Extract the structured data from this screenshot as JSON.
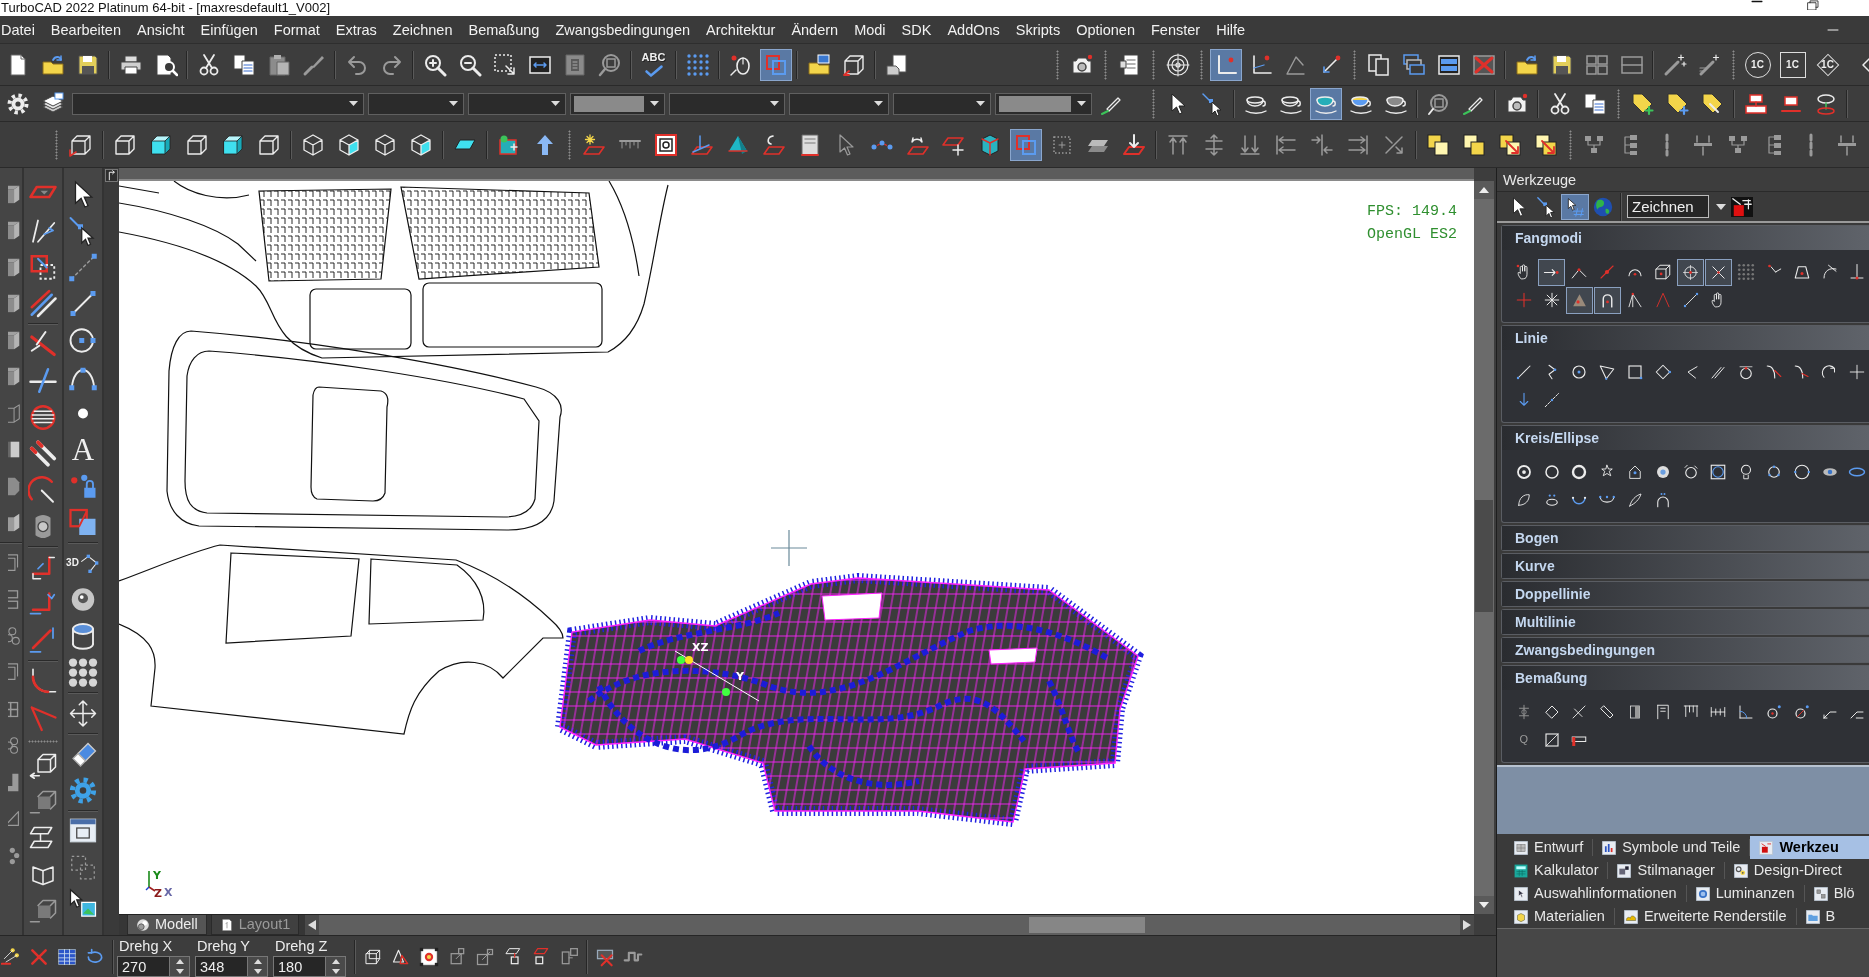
{
  "window": {
    "title": "TurboCAD 2022 Platinum 64-bit - [maxresdefault1_V002]"
  },
  "menu": [
    "Datei",
    "Bearbeiten",
    "Ansicht",
    "Einfügen",
    "Format",
    "Extras",
    "Zeichnen",
    "Bemaßung",
    "Zwangsbedingungen",
    "Architektur",
    "Ändern",
    "Modi",
    "SDK",
    "AddOns",
    "Skripts",
    "Optionen",
    "Fenster",
    "Hilfe"
  ],
  "toolbars": {
    "standard": [
      {
        "selected": false
      },
      {
        "selected": false
      },
      {
        "selected": false
      },
      {
        "selected": false
      },
      {
        "selected": false
      },
      {
        "selected": false
      },
      {
        "selected": false
      },
      {
        "selected": false
      },
      {
        "selected": false
      },
      {
        "selected": false
      },
      {
        "selected": false
      },
      {
        "selected": false
      },
      {
        "selected": false
      },
      {
        "selected": false
      },
      {
        "selected": false
      },
      {
        "selected": false
      },
      {
        "selected": false
      },
      {
        "selected": false,
        "label": "ABC"
      },
      {
        "selected": false
      },
      {
        "selected": false
      },
      {
        "selected": true
      },
      {
        "selected": false
      },
      {
        "selected": false
      },
      {
        "selected": false
      },
      {
        "selected": false
      },
      {
        "selected": false
      },
      {
        "selected": false
      },
      {
        "selected": true
      },
      {
        "selected": false
      },
      {
        "selected": false
      },
      {
        "selected": false
      },
      {
        "selected": false
      },
      {
        "selected": false
      },
      {
        "selected": false
      },
      {
        "selected": false
      },
      {
        "selected": false
      },
      {
        "selected": false
      },
      {
        "selected": false
      },
      {
        "selected": false
      },
      {
        "selected": false
      },
      {
        "selected": false
      },
      {
        "selected": false,
        "label": "1C"
      },
      {
        "selected": false,
        "label": "1C"
      },
      {
        "selected": false,
        "label": "1C"
      },
      {
        "selected": false
      }
    ],
    "properties": [
      {
        "selected": false
      },
      {
        "selected": false
      },
      {
        "selected": false
      },
      {
        "selected": false
      },
      {
        "selected": false
      },
      {
        "selected": false
      },
      {
        "selected": false
      },
      {
        "selected": true
      },
      {
        "selected": false
      },
      {
        "selected": false
      },
      {
        "selected": false
      },
      {
        "selected": false
      },
      {
        "selected": false
      },
      {
        "selected": false
      },
      {
        "selected": false
      },
      {
        "selected": false
      },
      {
        "selected": false
      },
      {
        "selected": false
      },
      {
        "selected": false
      },
      {
        "selected": false
      },
      {
        "selected": false
      }
    ],
    "view": [
      {
        "selected": false
      },
      {
        "selected": false
      },
      {
        "selected": false
      },
      {
        "selected": false
      },
      {
        "selected": false
      },
      {
        "selected": false
      },
      {
        "selected": false
      },
      {
        "selected": false
      },
      {
        "selected": false
      },
      {
        "selected": false
      },
      {
        "selected": false
      },
      {
        "selected": false
      },
      {
        "selected": false
      },
      {
        "selected": false
      },
      {
        "selected": false
      },
      {
        "selected": false
      },
      {
        "selected": false
      },
      {
        "selected": false
      },
      {
        "selected": false
      },
      {
        "selected": false
      },
      {
        "selected": false
      },
      {
        "selected": false
      },
      {
        "selected": false
      },
      {
        "selected": false
      },
      {
        "selected": false
      },
      {
        "selected": true
      },
      {
        "selected": false
      },
      {
        "selected": false
      },
      {
        "selected": false
      },
      {
        "selected": false
      },
      {
        "selected": false
      },
      {
        "selected": false
      },
      {
        "selected": false
      },
      {
        "selected": false
      },
      {
        "selected": false
      },
      {
        "selected": false
      },
      {
        "selected": false
      },
      {
        "selected": false
      },
      {
        "selected": false
      },
      {
        "selected": false
      },
      {
        "selected": false
      },
      {
        "selected": false
      },
      {
        "selected": false
      },
      {
        "selected": false
      },
      {
        "selected": false
      },
      {
        "selected": false
      },
      {
        "selected": false
      },
      {
        "selected": false
      }
    ],
    "left_1": [
      {
        "selected": false
      },
      {
        "selected": false
      },
      {
        "selected": false
      },
      {
        "selected": false
      },
      {
        "selected": false
      },
      {
        "selected": false
      },
      {
        "selected": false
      },
      {
        "selected": false
      },
      {
        "selected": false
      },
      {
        "selected": false
      },
      {
        "selected": false
      },
      {
        "selected": false
      },
      {
        "selected": false
      },
      {
        "selected": false
      },
      {
        "selected": false
      },
      {
        "selected": false
      },
      {
        "selected": false
      },
      {
        "selected": false
      },
      {
        "selected": false
      }
    ],
    "left_2": [
      {
        "selected": false
      },
      {
        "selected": false
      },
      {
        "selected": false
      },
      {
        "selected": false
      },
      {
        "selected": false
      },
      {
        "selected": false
      },
      {
        "selected": false
      },
      {
        "selected": false
      },
      {
        "selected": false
      },
      {
        "selected": false
      },
      {
        "selected": false
      },
      {
        "selected": false
      },
      {
        "selected": false
      },
      {
        "selected": false
      },
      {
        "selected": false
      },
      {
        "selected": false
      },
      {
        "selected": false
      },
      {
        "selected": false
      },
      {
        "selected": false
      },
      {
        "selected": false
      }
    ],
    "left_3": [
      {
        "selected": false
      },
      {
        "selected": false
      },
      {
        "selected": false
      },
      {
        "selected": false
      },
      {
        "selected": false
      },
      {
        "selected": false
      },
      {
        "selected": false
      },
      {
        "selected": false,
        "label": "A"
      },
      {
        "selected": false
      },
      {
        "selected": false
      },
      {
        "selected": false,
        "label": "3D"
      },
      {
        "selected": false
      },
      {
        "selected": false
      },
      {
        "selected": false
      },
      {
        "selected": false
      },
      {
        "selected": false
      },
      {
        "selected": false
      },
      {
        "selected": false
      },
      {
        "selected": false
      },
      {
        "selected": false
      }
    ]
  },
  "canvas": {
    "fps": "FPS: 149.4",
    "renderer": "OpenGL ES2",
    "snap_axes": [
      "XZ",
      "Y"
    ],
    "axes": [
      "Y",
      "Z",
      "X"
    ]
  },
  "layout_tabs": [
    {
      "label": "Modell",
      "selected": true
    },
    {
      "label": "Layout1",
      "selected": false
    }
  ],
  "status_bar": {
    "fields": [
      {
        "label": "Drehg X",
        "value": "270"
      },
      {
        "label": "Drehg Y",
        "value": "348"
      },
      {
        "label": "Drehg Z",
        "value": "180"
      }
    ]
  },
  "tool_palette": {
    "title": "Werkzeuge",
    "buttons": [
      {
        "selected": false
      },
      {
        "selected": false
      },
      {
        "selected": true
      },
      {
        "selected": false
      }
    ],
    "mode": "Zeichnen",
    "sections": [
      {
        "title": "Fangmodi",
        "expanded": true,
        "tools": [
          {
            "selected": false
          },
          {
            "selected": true
          },
          {
            "selected": false
          },
          {
            "selected": false
          },
          {
            "selected": false
          },
          {
            "selected": false
          },
          {
            "selected": true
          },
          {
            "selected": true
          },
          {
            "selected": false
          },
          {
            "selected": false
          },
          {
            "selected": false
          },
          {
            "selected": false
          },
          {
            "selected": false
          },
          {
            "selected": false
          },
          {
            "selected": false
          },
          {
            "selected": true
          },
          {
            "selected": true
          },
          {
            "selected": false
          },
          {
            "selected": false
          },
          {
            "selected": false
          },
          {
            "selected": false
          }
        ]
      },
      {
        "title": "Linie",
        "expanded": true,
        "tools": [
          {
            "selected": false
          },
          {
            "selected": false
          },
          {
            "selected": false
          },
          {
            "selected": false
          },
          {
            "selected": false
          },
          {
            "selected": false
          },
          {
            "selected": false
          },
          {
            "selected": false
          },
          {
            "selected": false
          },
          {
            "selected": false
          },
          {
            "selected": false
          },
          {
            "selected": false
          },
          {
            "selected": false
          },
          {
            "selected": false
          },
          {
            "selected": false
          }
        ]
      },
      {
        "title": "Kreis/Ellipse",
        "expanded": true,
        "tools": [
          {
            "selected": false
          },
          {
            "selected": false
          },
          {
            "selected": false
          },
          {
            "selected": false
          },
          {
            "selected": false
          },
          {
            "selected": false
          },
          {
            "selected": false
          },
          {
            "selected": false
          },
          {
            "selected": false
          },
          {
            "selected": false
          },
          {
            "selected": false
          },
          {
            "selected": false
          },
          {
            "selected": false
          },
          {
            "selected": false
          },
          {
            "selected": false
          },
          {
            "selected": false
          },
          {
            "selected": false
          },
          {
            "selected": false
          },
          {
            "selected": false
          }
        ]
      },
      {
        "title": "Bogen",
        "expanded": false
      },
      {
        "title": "Kurve",
        "expanded": false
      },
      {
        "title": "Doppellinie",
        "expanded": false
      },
      {
        "title": "Multilinie",
        "expanded": false
      },
      {
        "title": "Zwangsbedingungen",
        "expanded": false
      },
      {
        "title": "Bemaßung",
        "expanded": true,
        "tools": [
          {
            "selected": false
          },
          {
            "selected": false
          },
          {
            "selected": false
          },
          {
            "selected": false
          },
          {
            "selected": false
          },
          {
            "selected": false
          },
          {
            "selected": false
          },
          {
            "selected": false
          },
          {
            "selected": false
          },
          {
            "selected": false
          },
          {
            "selected": false
          },
          {
            "selected": false
          },
          {
            "selected": false
          },
          {
            "selected": false,
            "label": "Q"
          },
          {
            "selected": false
          },
          {
            "selected": false
          }
        ]
      }
    ]
  },
  "panel_tabs": [
    [
      {
        "label": "Entwurf",
        "selected": false
      },
      {
        "label": "Symbole und Teile",
        "selected": false
      },
      {
        "label": "Werkzeu",
        "selected": true
      }
    ],
    [
      {
        "label": "Kalkulator",
        "selected": false
      },
      {
        "label": "Stilmanager",
        "selected": false
      },
      {
        "label": "Design-Direct",
        "selected": false
      }
    ],
    [
      {
        "label": "Auswahlinformationen",
        "selected": false
      },
      {
        "label": "Luminanzen",
        "selected": false
      },
      {
        "label": "Blö",
        "selected": false
      }
    ],
    [
      {
        "label": "Materialien",
        "selected": false
      },
      {
        "label": "Erweiterte Renderstile",
        "selected": false
      },
      {
        "label": "B",
        "selected": false
      }
    ]
  ]
}
